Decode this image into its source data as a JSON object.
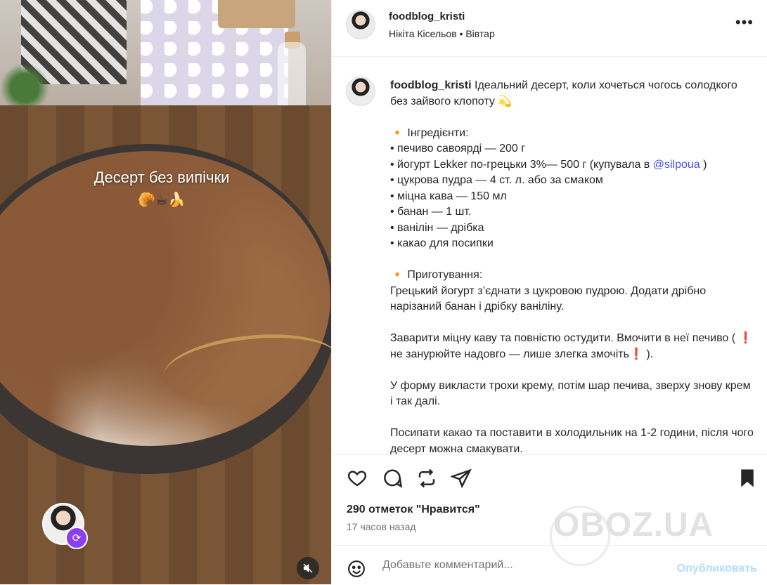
{
  "media": {
    "overlay_title": "Десерт без випічки",
    "overlay_emoji": "🥐☕🍌"
  },
  "header": {
    "username": "foodblog_kristi",
    "subtitle": "Нікіта Кісельов • Вівтар",
    "more_label": "•••"
  },
  "caption": {
    "username": "foodblog_kristi",
    "intro": "Ідеальний десерт, коли хочеться чогось солодкого без зайвого клопоту 💫",
    "ingredients_header": "🔸 Інгредієнти:",
    "ingredients": [
      "• печиво савоярді — 200 г",
      "• йогурт Lekker по-грецьки 3%— 500 г (купувала в ",
      "• цукрова пудра — 4 ст. л. або за смаком",
      "• міцна кава — 150 мл",
      "• банан — 1 шт.",
      "• ванілін — дрібка",
      "• какао для посипки"
    ],
    "mention": "@silpoua",
    "mention_close": " )",
    "method_header": "🔸 Приготування:",
    "step1": "Грецький йогурт з’єднати з цукровою пудрою. Додати дрібно нарізаний банан і дрібку ваніліну.",
    "step2_a": "Заварити міцну каву та повністю остудити. Вмочити в неї печиво ( ",
    "step2_b": " не занурюйте надовго — лише злегка змочіть",
    "step2_c": " ).",
    "bang": "❗",
    "step3": "У форму викласти трохи крему, потім шар печива, зверху знову крем і так далі.",
    "step4": "Посипати какао та поставити в холодильник на 1-2 години, після чого десерт можна смакувати."
  },
  "engagement": {
    "likes": "290 отметок \"Нравится\"",
    "time_ago": "17 часов назад"
  },
  "comment": {
    "placeholder": "Добавьте комментарий...",
    "post_label": "Опубликовать"
  },
  "watermark": "OBOZ.UA",
  "colors": {
    "mention": "#4150f7",
    "post_button": "#b3dbff",
    "badge": "#8e3ef2"
  }
}
